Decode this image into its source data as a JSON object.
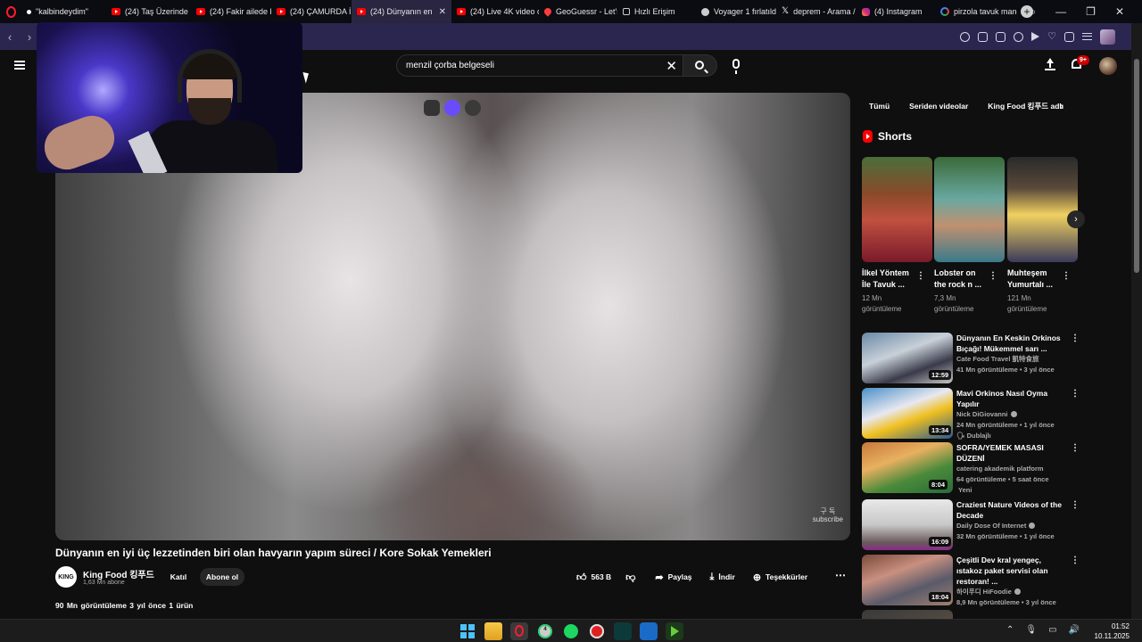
{
  "browser": {
    "tabs": [
      {
        "label": "\"kalbindeydim\"",
        "icon": "dot-icon",
        "active": false
      },
      {
        "label": "(24) Taş Üzerinde R",
        "icon": "youtube-icon",
        "active": false
      },
      {
        "label": "(24) Fakir ailede ked",
        "icon": "youtube-icon",
        "active": false
      },
      {
        "label": "(24) ÇAMURDA İLİK",
        "icon": "youtube-icon",
        "active": false
      },
      {
        "label": "(24) Dünyanın en iyi ü",
        "icon": "youtube-icon",
        "active": true
      },
      {
        "label": "(24) Live 4K video o",
        "icon": "youtube-icon",
        "active": false
      },
      {
        "label": "GeoGuessr - Let's e",
        "icon": "pin-icon",
        "active": false
      },
      {
        "label": "Hızlı Erişim",
        "icon": "grid-icon",
        "active": false
      },
      {
        "label": "Voyager 1 fırlatıldı",
        "icon": "rocket-icon",
        "active": false
      },
      {
        "label": "deprem - Arama / X",
        "icon": "x-icon",
        "active": false
      },
      {
        "label": "(4) Instagram",
        "icon": "instagram-icon",
        "active": false
      },
      {
        "label": "pirzola tavuk mang",
        "icon": "google-icon",
        "active": false
      }
    ],
    "new_tab": "+",
    "window_controls": [
      "⌕",
      "—",
      "❐",
      "✕"
    ]
  },
  "youtube": {
    "search": {
      "value": "menzil çorba belgeseli",
      "clear": "✕"
    },
    "notification_count": "9+",
    "video": {
      "title": "Dünyanın en iyi üç lezzetinden biri olan havyarın yapım süreci / Kore Sokak Yemekleri",
      "watermark_line1": "구 독",
      "watermark_line2": "subscribe",
      "channel": {
        "name": "King Food 킹푸드",
        "subs": "1,63 Mn abone",
        "avatar_text": "KING"
      },
      "join_label": "Katıl",
      "subscribe_label": "Abone ol",
      "actions": {
        "like": "563 B",
        "share": "Paylaş",
        "download": "İndir",
        "thanks": "Teşekkürler",
        "more": "⋯"
      },
      "stats": "90 Mn görüntüleme  3 yıl önce  1 ürün"
    },
    "filter_chips": [
      "Tümü",
      "Seriden videolar",
      "King Food 킹푸드 adlı"
    ],
    "shorts": {
      "heading": "Shorts",
      "items": [
        {
          "title": "İlkel Yöntem İle Tavuk ...",
          "views": "12 Mn görüntüleme"
        },
        {
          "title": "Lobster on the rock n ...",
          "views": "7,3 Mn görüntüleme"
        },
        {
          "title": "Muhteşem Yumurtalı ...",
          "views": "121 Mn görüntüleme"
        }
      ]
    },
    "recommendations": [
      {
        "title": "Dünyanın En Keskin Orkinos Bıçağı! Mükemmel sarı ...",
        "channel": "Cate Food Travel 凱特食旅",
        "meta": "41 Mn görüntüleme • 3 yıl önce",
        "badge": "",
        "duration": "12:59"
      },
      {
        "title": "Mavi Orkinos Nasıl Oyma Yapılır",
        "channel": "Nick DiGiovanni",
        "meta": "24 Mn görüntüleme • 1 yıl önce",
        "badge": "Dublajlı",
        "duration": "13:34"
      },
      {
        "title": "SOFRA/YEMEK MASASI DÜZENİ",
        "channel": "catering akademik platform",
        "meta": "64 görüntüleme • 5 saat önce",
        "badge": "Yeni",
        "duration": "8:04"
      },
      {
        "title": "Craziest Nature Videos of the Decade",
        "channel": "Daily Dose Of Internet",
        "meta": "32 Mn görüntüleme • 1 yıl önce",
        "badge": "",
        "duration": "16:09"
      },
      {
        "title": "Çeşitli Dev kral yengeç, ıstakoz paket servisi olan restoran! ...",
        "channel": "하이푸디 HiFoodie",
        "meta": "8,9 Mn görüntüleme • 3 yıl önce",
        "badge": "",
        "duration": "18:04"
      }
    ]
  },
  "taskbar": {
    "time": "01:52",
    "date": "10.11.2025",
    "whatsapp_badge": "4",
    "tray": [
      "⌃",
      "🎙",
      "▭",
      "🔊"
    ]
  }
}
